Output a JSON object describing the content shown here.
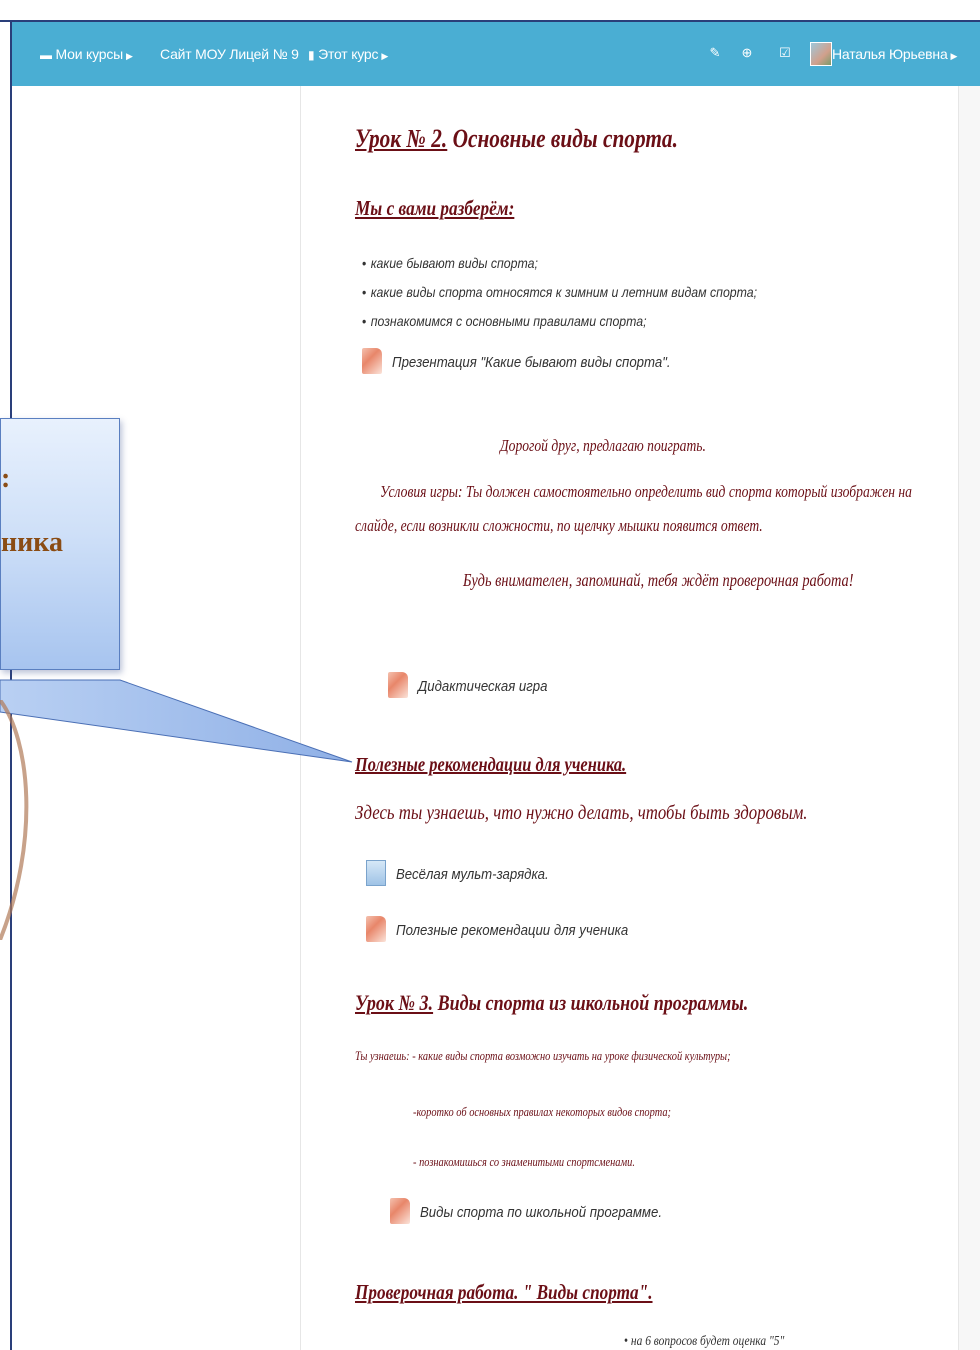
{
  "navbar": {
    "my_courses": "Мои курсы",
    "site": "Сайт МОУ Лицей № 9",
    "this_course": "Этот курс",
    "user_name": "Наталья Юрьевна",
    "icons": [
      "edit-icon",
      "compass-icon",
      "checkbox-icon"
    ]
  },
  "lesson2": {
    "number": "Урок № 2.",
    "title": " Основные виды спорта.",
    "review_heading": "Мы с вами  разберём:",
    "bullets": [
      "какие бывают виды спорта;",
      "какие виды спорта относятся к зимним и летним видам спорта;",
      "познакомимся с основными правилами спорта;"
    ],
    "presentation": "Презентация \"Какие бывают виды спорта\".",
    "game_invite": "Дорогой друг, предлагаю поиграть.",
    "game_conditions_1": "Условия игры: Ты должен самостоятельно определить вид спорта который изображен на",
    "game_conditions_2": "слайде, если возникли сложности, по щелчку мышки появится ответ.",
    "attention": "Будь внимателен, запоминай, тебя ждёт проверочная работа!",
    "didactic_game": "Дидактическая игра"
  },
  "recommendations": {
    "heading": "Полезные рекомендации для ученика.",
    "intro": "Здесь ты узнаешь, что нужно делать, чтобы быть здоровым.",
    "exercise": "Весёлая мульт-зарядка.",
    "resource": "Полезные рекомендации для ученика"
  },
  "lesson3": {
    "number": "Урок № 3.",
    "title": " Виды спорта из школьной программы.",
    "learn_1": "Ты узнаешь: - какие виды спорта возможно изучать на уроке физической культуры;",
    "learn_2": "-коротко об основных правилах некоторых видов спорта;",
    "learn_3": "- познакомишься со знаменитыми спортсменами.",
    "resource": "Виды спорта по школьной программе."
  },
  "test": {
    "heading": "Проверочная работа. \" Виды спорта\".",
    "grade_note": "на 6 вопросов будет оценка \"5\""
  },
  "callout": {
    "line1": ":",
    "line2": "ника"
  },
  "colors": {
    "navbar": "#4aaed3",
    "heading": "#6b0f16",
    "callout_text": "#8a4c14"
  }
}
